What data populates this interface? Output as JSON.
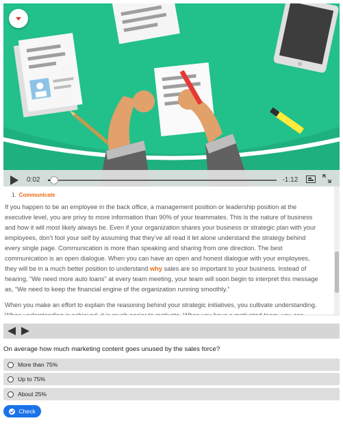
{
  "video": {
    "current_time": "0:02",
    "remaining_time": "-1:12",
    "progress": 0.025,
    "icons": {
      "menu": "chevron-down-icon",
      "play": "play-icon",
      "captions": "captions-icon",
      "fullscreen": "fullscreen-icon"
    }
  },
  "article": {
    "heading_number": "1.",
    "heading_title": "Communicate",
    "p1_before": "If you happen to be an employee in the back office, a management position or leadership position at the executive level, you are privy to more information than 90% of your teammates. This is the nature of business and how it will most likely always be. Even if your organization shares your business or strategic plan with your employees, don’t fool your self by assuming that they’ve all read it let alone understand the strategy behind every single page. Communication is more than speaking and sharing from one direction. The best communication is an open dialogue. When you can have an open and honest dialogue with your employees, they will be in a much better position to understand ",
    "p1_highlight": "why",
    "p1_after": " sales are so important to your business. Instead of hearing, “We need more auto loans” at every team meeting, your team will soon begin to interpret this message as, “We need to keep the financial engine of the organization running smoothly.”",
    "p2": "When you make an effort to explain the reasoning behind your strategic initiatives, you cultivate understanding.   When understanding is achieved, it is much easier to motivate. When you have a motivated team, you can accomplish anything you and your team put your minds to."
  },
  "quiz": {
    "question": "On average how much marketing content goes unused by the sales force?",
    "options": [
      {
        "label": "More than 75%"
      },
      {
        "label": "Up to 75%"
      },
      {
        "label": "About 25%"
      }
    ],
    "check_label": "Check"
  },
  "colors": {
    "accent_orange": "#e96a12",
    "button_blue": "#1a73e8",
    "video_green": "#22c08a"
  }
}
